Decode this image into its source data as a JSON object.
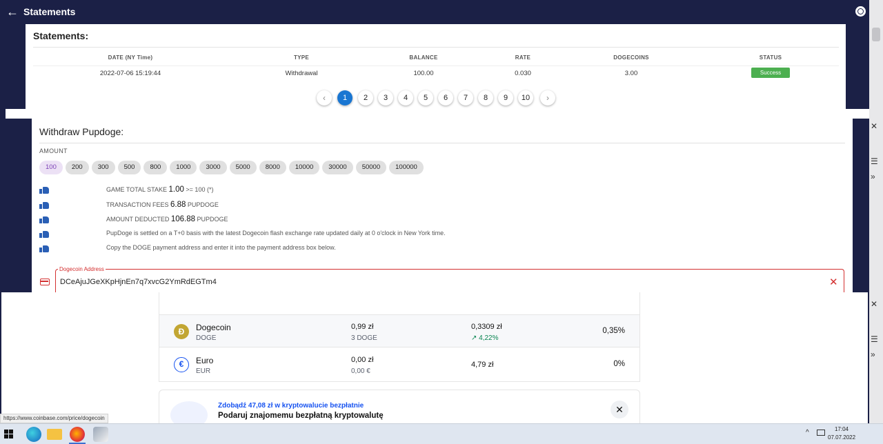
{
  "appbar": {
    "title": "Statements",
    "back_icon": "arrow-left-icon",
    "globe_icon": "globe-icon"
  },
  "statements": {
    "heading": "Statements:",
    "columns": [
      "DATE (NY Time)",
      "TYPE",
      "BALANCE",
      "RATE",
      "DOGECOINS",
      "STATUS"
    ],
    "rows": [
      {
        "date": "2022-07-06 15:19:44",
        "type": "Withdrawal",
        "balance": "100.00",
        "rate": "0.030",
        "dogecoins": "3.00",
        "status": "Success"
      }
    ],
    "status_color": "#4caf50",
    "pagination": {
      "prev": "‹",
      "next": "›",
      "pages": [
        "1",
        "2",
        "3",
        "4",
        "5",
        "6",
        "7",
        "8",
        "9",
        "10"
      ],
      "current": "1"
    }
  },
  "withdraw": {
    "heading": "Withdraw Pupdoge:",
    "amount_label": "AMOUNT",
    "amounts": [
      "100",
      "200",
      "300",
      "500",
      "800",
      "1000",
      "3000",
      "5000",
      "8000",
      "10000",
      "30000",
      "50000",
      "100000"
    ],
    "selected_amount": "100",
    "info": [
      {
        "prefix": "GAME TOTAL STAKE ",
        "value": "1.00",
        "suffix": " >= 100 (*)"
      },
      {
        "prefix": "TRANSACTION FEES ",
        "value": "6.88",
        "suffix": " PUPDOGE"
      },
      {
        "prefix": "AMOUNT DEDUCTED ",
        "value": "106.88",
        "suffix": " PUPDOGE"
      },
      {
        "prefix": "PupDoge is settled on a T+0 basis with the latest Dogecoin flash exchange rate updated daily at 0 o'clock in New York time.",
        "value": "",
        "suffix": ""
      },
      {
        "prefix": "Copy the DOGE payment address and enter it into the payment address box below.",
        "value": "",
        "suffix": ""
      }
    ],
    "address": {
      "label": "Dogecoin Address",
      "value": "DCeAjuJGeXKpHjnEn7q7xvcG2YmRdEGTm4"
    },
    "error_color": "#d32f2f"
  },
  "coinbase": {
    "assets": [
      {
        "name": "Dogecoin",
        "symbol": "DOGE",
        "icon": "Ð",
        "balance": "0,99 zł",
        "balance_sub": "3 DOGE",
        "price": "0,3309 zł",
        "change": "↗ 4,22%",
        "allocation": "0,35%"
      },
      {
        "name": "Euro",
        "symbol": "EUR",
        "icon": "€",
        "balance": "0,00 zł",
        "balance_sub": "0,00 €",
        "price": "4,79 zł",
        "change": "",
        "allocation": "0%"
      }
    ],
    "promo": {
      "title": "Zdobądź 47,08 zł w kryptowalucie bezpłatnie",
      "subtitle": "Podaruj znajomemu bezpłatną kryptowalutę",
      "close": "✕"
    },
    "accent_color": "#1652f0"
  },
  "status_url": "https://www.coinbase.com/price/dogecoin",
  "taskbar": {
    "time": "17:04",
    "date": "07.07.2022",
    "tray_icon": "^"
  }
}
